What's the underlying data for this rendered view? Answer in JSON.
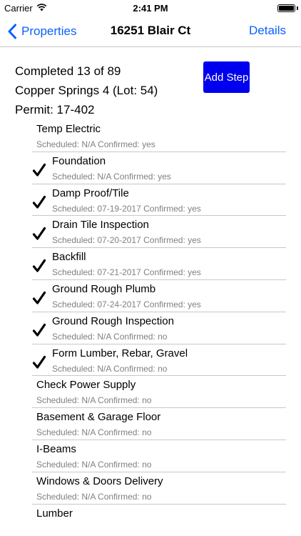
{
  "status_bar": {
    "carrier": "Carrier",
    "time": "2:41 PM"
  },
  "nav": {
    "back_label": "Properties",
    "title": "16251 Blair Ct",
    "right_label": "Details"
  },
  "summary": {
    "completed": "Completed 13 of 89",
    "subdivision": "Copper Springs 4 (Lot: 54)",
    "permit": "Permit: 17-402",
    "add_step_label": "Add Step",
    "add_step_color": "#0000ee"
  },
  "accent_color": "#0a60ff",
  "steps": [
    {
      "name": "Temp Electric",
      "meta": "Scheduled: N/A Confirmed: yes",
      "checked": false
    },
    {
      "name": "Foundation",
      "meta": "Scheduled: N/A Confirmed: yes",
      "checked": true
    },
    {
      "name": "Damp Proof/Tile",
      "meta": "Scheduled: 07-19-2017 Confirmed: yes",
      "checked": true
    },
    {
      "name": "Drain Tile Inspection",
      "meta": "Scheduled: 07-20-2017 Confirmed: yes",
      "checked": true
    },
    {
      "name": "Backfill",
      "meta": "Scheduled: 07-21-2017 Confirmed: yes",
      "checked": true
    },
    {
      "name": "Ground Rough Plumb",
      "meta": "Scheduled: 07-24-2017 Confirmed: yes",
      "checked": true
    },
    {
      "name": "Ground Rough Inspection",
      "meta": "Scheduled: N/A Confirmed: no",
      "checked": true
    },
    {
      "name": "Form Lumber, Rebar, Gravel",
      "meta": "Scheduled: N/A Confirmed: no",
      "checked": true
    },
    {
      "name": "Check Power Supply",
      "meta": "Scheduled: N/A Confirmed: no",
      "checked": false
    },
    {
      "name": "Basement & Garage Floor",
      "meta": "Scheduled: N/A Confirmed: no",
      "checked": false
    },
    {
      "name": "I-Beams",
      "meta": "Scheduled: N/A Confirmed: no",
      "checked": false
    },
    {
      "name": "Windows & Doors Delivery",
      "meta": "Scheduled: N/A Confirmed: no",
      "checked": false
    },
    {
      "name": "Lumber",
      "meta": "",
      "checked": false
    }
  ],
  "icons": {
    "back": "chevron-left-icon",
    "check": "check-icon",
    "wifi": "wifi-icon",
    "battery": "battery-icon"
  }
}
